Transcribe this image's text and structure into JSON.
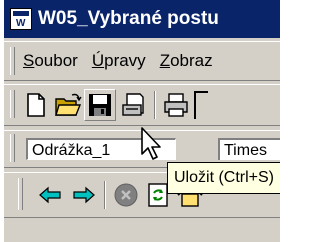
{
  "window": {
    "title": "W05_Vybrané postu"
  },
  "menu": {
    "items": [
      {
        "accel": "S",
        "rest": "oubor"
      },
      {
        "accel": "Ú",
        "rest": "pravy"
      },
      {
        "accel": "Z",
        "rest": "obraz"
      }
    ]
  },
  "toolbar_standard": {
    "buttons": [
      "new-document",
      "open-folder",
      "save",
      "print-preview",
      "print"
    ]
  },
  "toolbar_formatting": {
    "style_value": "Odrážka_1",
    "font_value": "Times"
  },
  "toolbar_web": {
    "buttons": [
      "back",
      "forward",
      "stop",
      "refresh",
      "home"
    ]
  },
  "tooltip": {
    "text": "Uložit (Ctrl+S)"
  },
  "colors": {
    "title_bar": "#0a246a",
    "face": "#d4d0c8",
    "tooltip_bg": "#ffffe1",
    "arrow_cyan": "#00c0c0"
  }
}
